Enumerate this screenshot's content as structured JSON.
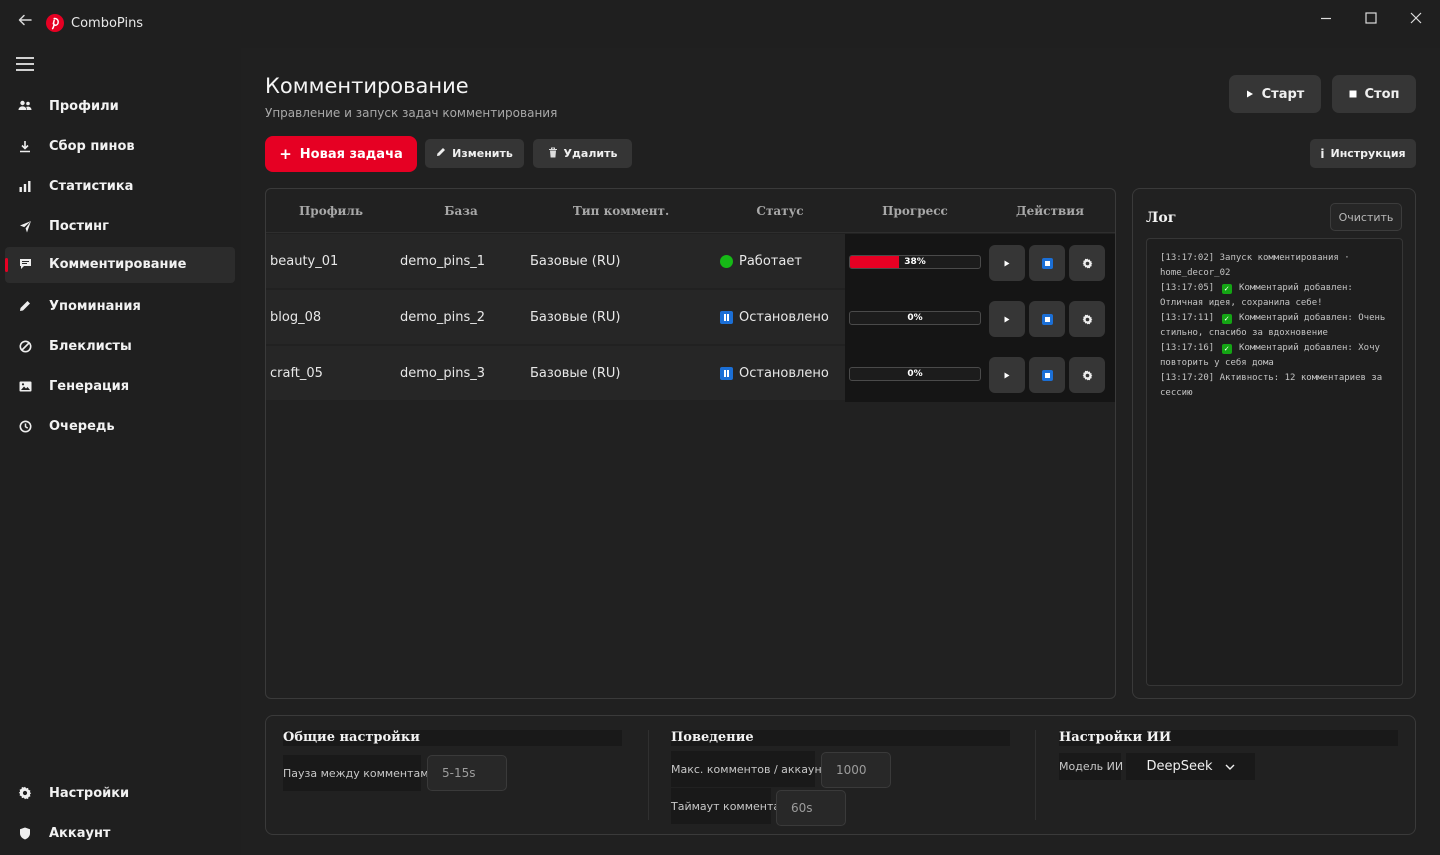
{
  "app": {
    "title": "ComboPins",
    "brand_color": "#e60023"
  },
  "sidebar": {
    "items": [
      {
        "label": "Профили",
        "icon": "users-icon"
      },
      {
        "label": "Сбор пинов",
        "icon": "download-icon"
      },
      {
        "label": "Статистика",
        "icon": "bar-chart-icon"
      },
      {
        "label": "Постинг",
        "icon": "send-icon"
      },
      {
        "label": "Комментирование",
        "icon": "comment-icon",
        "active": true
      },
      {
        "label": "Упоминания",
        "icon": "pencil-icon"
      },
      {
        "label": "Блеклисты",
        "icon": "block-icon"
      },
      {
        "label": "Генерация",
        "icon": "image-icon"
      },
      {
        "label": "Очередь",
        "icon": "clock-icon"
      }
    ],
    "bottom": [
      {
        "label": "Настройки",
        "icon": "gear-icon"
      },
      {
        "label": "Аккаунт",
        "icon": "shield-icon"
      }
    ]
  },
  "page": {
    "title": "Комментирование",
    "subtitle": "Управление и запуск задач комментирования"
  },
  "toolbar": {
    "start": "Старт",
    "stop": "Стоп",
    "new_task": "Новая задача",
    "edit": "Изменить",
    "delete": "Удалить",
    "instructions": "Инструкция"
  },
  "table": {
    "headers": [
      "Профиль",
      "База",
      "Тип коммент.",
      "Статус",
      "Прогресс",
      "Действия"
    ],
    "rows": [
      {
        "profile": "beauty_01",
        "base": "demo_pins_1",
        "type": "Базовые (RU)",
        "status": "Работает",
        "status_kind": "running",
        "progress": 38,
        "progress_label": "38%"
      },
      {
        "profile": "blog_08",
        "base": "demo_pins_2",
        "type": "Базовые (RU)",
        "status": "Остановлено",
        "status_kind": "paused",
        "progress": 0,
        "progress_label": "0%"
      },
      {
        "profile": "craft_05",
        "base": "demo_pins_3",
        "type": "Базовые (RU)",
        "status": "Остановлено",
        "status_kind": "paused",
        "progress": 0,
        "progress_label": "0%"
      }
    ]
  },
  "log": {
    "title": "Лог",
    "clear": "Очистить",
    "lines": [
      {
        "time": "[13:17:02]",
        "check": false,
        "text": "Запуск комментирования · home_decor_02"
      },
      {
        "time": "[13:17:05]",
        "check": true,
        "text": "Комментарий добавлен: Отличная идея, сохранила себе!"
      },
      {
        "time": "[13:17:11]",
        "check": true,
        "text": "Комментарий добавлен: Очень стильно, спасибо за вдохновение"
      },
      {
        "time": "[13:17:16]",
        "check": true,
        "text": "Комментарий добавлен: Хочу повторить у себя дома"
      },
      {
        "time": "[13:17:20]",
        "check": false,
        "text": "Активность: 12 комментариев за сессию"
      }
    ]
  },
  "settings": {
    "general": {
      "title": "Общие настройки",
      "pause_label": "Пауза между комментами",
      "pause_value": "5-15s"
    },
    "behavior": {
      "title": "Поведение",
      "max_label": "Макс. комментов / аккаунт",
      "max_value": "1000",
      "timeout_label": "Таймаут коммента",
      "timeout_value": "60s"
    },
    "ai": {
      "title": "Настройки ИИ",
      "model_label": "Модель ИИ",
      "model_value": "DeepSeek"
    }
  }
}
